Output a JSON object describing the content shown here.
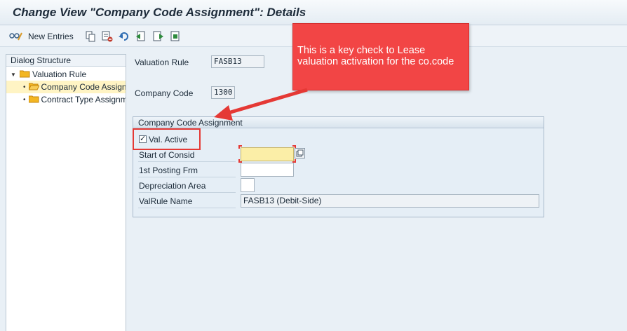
{
  "window": {
    "title": "Change View \"Company Code Assignment\": Details"
  },
  "toolbar": {
    "new_entries_label": "New Entries",
    "icons": [
      "glasses-pencil-icon",
      "copy-icon",
      "delete-icon",
      "undo-icon",
      "export-icon",
      "import-icon",
      "select-icon"
    ]
  },
  "dialog_structure": {
    "header": "Dialog Structure",
    "items": [
      {
        "label": "Valuation Rule",
        "level": 0,
        "expanded": true,
        "selected": false
      },
      {
        "label": "Company Code Assignment",
        "level": 1,
        "selected": true
      },
      {
        "label": "Contract Type Assignment",
        "level": 1,
        "selected": false
      }
    ]
  },
  "header_fields": {
    "valuation_rule": {
      "label": "Valuation Rule",
      "value": "FASB13"
    },
    "company_code": {
      "label": "Company Code",
      "value": "1300"
    }
  },
  "group": {
    "title": "Company Code Assignment",
    "val_active": {
      "label": "Val. Active",
      "checked": true
    },
    "start_of_consid": {
      "label": "Start of Consid",
      "value": ""
    },
    "first_posting": {
      "label": "1st Posting Frm",
      "value": ""
    },
    "depreciation_area": {
      "label": "Depreciation Area",
      "value": ""
    },
    "valrule_name": {
      "label": "ValRule Name",
      "value": "FASB13 (Debit-Side)"
    }
  },
  "annotation": {
    "text": "This is a key check to Lease valuation activation for the co.code",
    "color": "#f24545"
  },
  "colors": {
    "background": "#e9f0f6",
    "selected_tree_row": "#fff4c4",
    "required_field": "#fbeea7",
    "highlight": "#e53935"
  }
}
